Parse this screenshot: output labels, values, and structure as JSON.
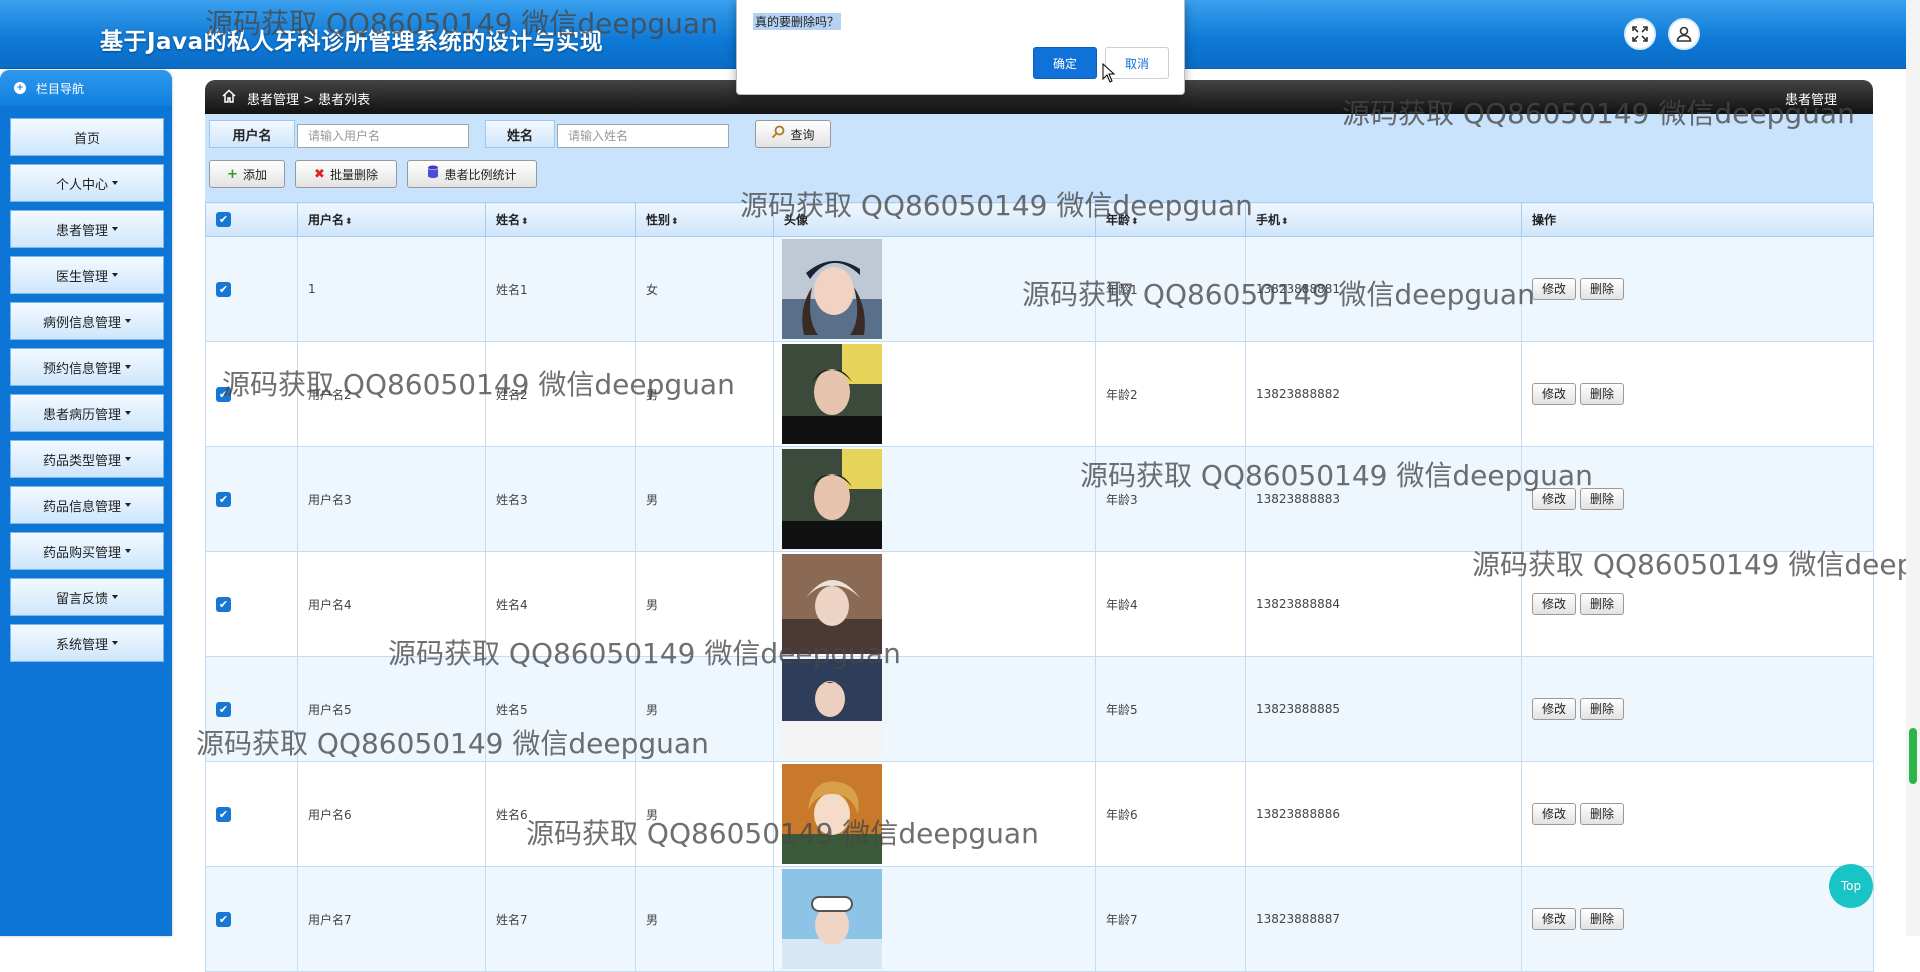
{
  "header": {
    "title": "基于Java的私人牙科诊所管理系统的设计与实现"
  },
  "sidebar": {
    "heading": "栏目导航",
    "items": [
      {
        "label": "首页",
        "dropdown": false
      },
      {
        "label": "个人中心",
        "dropdown": true
      },
      {
        "label": "患者管理",
        "dropdown": true
      },
      {
        "label": "医生管理",
        "dropdown": true
      },
      {
        "label": "病例信息管理",
        "dropdown": true
      },
      {
        "label": "预约信息管理",
        "dropdown": true
      },
      {
        "label": "患者病历管理",
        "dropdown": true
      },
      {
        "label": "药品类型管理",
        "dropdown": true
      },
      {
        "label": "药品信息管理",
        "dropdown": true
      },
      {
        "label": "药品购买管理",
        "dropdown": true
      },
      {
        "label": "留言反馈",
        "dropdown": true
      },
      {
        "label": "系统管理",
        "dropdown": true
      }
    ]
  },
  "breadcrumb": {
    "path": "患者管理 > 患者列表",
    "right": "患者管理"
  },
  "search": {
    "username_label": "用户名",
    "username_placeholder": "请输入用户名",
    "name_label": "姓名",
    "name_placeholder": "请输入姓名",
    "query_label": "查询"
  },
  "toolbar": {
    "add_label": "添加",
    "batch_delete_label": "批量删除",
    "stats_label": "患者比例统计"
  },
  "table": {
    "headers": [
      "用户名",
      "姓名",
      "性别",
      "头像",
      "年龄",
      "手机",
      "操作"
    ],
    "edit_label": "修改",
    "delete_label": "删除",
    "rows": [
      {
        "username": "1",
        "name": "姓名1",
        "gender": "女",
        "age": "年龄1",
        "phone": "13823888881"
      },
      {
        "username": "用户名2",
        "name": "姓名2",
        "gender": "男",
        "age": "年龄2",
        "phone": "13823888882"
      },
      {
        "username": "用户名3",
        "name": "姓名3",
        "gender": "男",
        "age": "年龄3",
        "phone": "13823888883"
      },
      {
        "username": "用户名4",
        "name": "姓名4",
        "gender": "男",
        "age": "年龄4",
        "phone": "13823888884"
      },
      {
        "username": "用户名5",
        "name": "姓名5",
        "gender": "男",
        "age": "年龄5",
        "phone": "13823888885"
      },
      {
        "username": "用户名6",
        "name": "姓名6",
        "gender": "男",
        "age": "年龄6",
        "phone": "13823888886"
      },
      {
        "username": "用户名7",
        "name": "姓名7",
        "gender": "男",
        "age": "年龄7",
        "phone": "13823888887"
      }
    ]
  },
  "dialog": {
    "message": "真的要删除吗？",
    "ok_label": "确定",
    "cancel_label": "取消"
  },
  "top_button": "Top",
  "watermark": "源码获取 QQ86050149 微信deepguan",
  "colors": {
    "header": "#0d78d6",
    "sidebar": "#0d75d6",
    "primary": "#1071d8",
    "top_button": "#19c4c4"
  }
}
